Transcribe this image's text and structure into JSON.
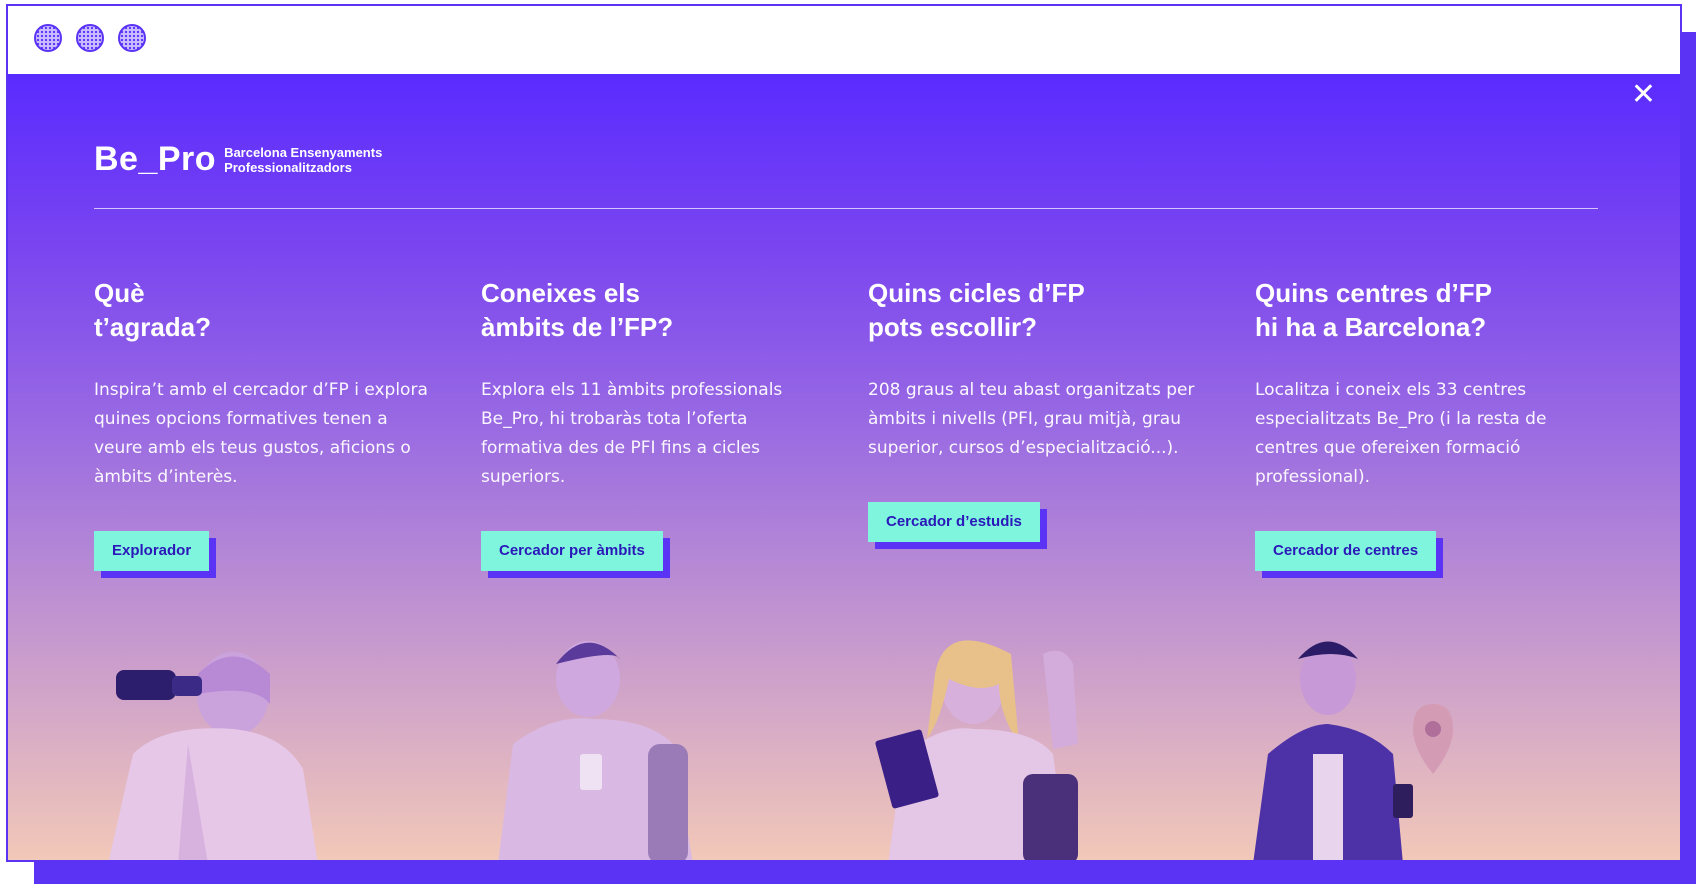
{
  "window": {
    "title": ""
  },
  "modal": {
    "close_label": "✕"
  },
  "logo": {
    "mark": "Be_Pro",
    "line1": "Barcelona Ensenyaments",
    "line2": "Professionalitzadors"
  },
  "columns": [
    {
      "title": "Què\nt’agrada?",
      "text": "Inspira’t amb el cercador d’FP i explora quines opcions formatives tenen a veure amb els teus gustos, aficions o àmbits d’interès.",
      "button": "Explorador"
    },
    {
      "title": "Coneixes els\nàmbits de l’FP?",
      "text": "Explora els 11 àmbits professionals Be_Pro, hi trobaràs tota l’oferta formativa des de PFI fins a cicles superiors.",
      "button": "Cercador per àmbits"
    },
    {
      "title": "Quins cicles d’FP\npots escollir?",
      "text": "208 graus al teu abast organitzats per àmbits i nivells (PFI, grau mitjà, grau superior, cursos d’especialització...).",
      "button": "Cercador d’estudis"
    },
    {
      "title": "Quins centres d’FP\nhi ha a Barcelona?",
      "text": "Localitza i coneix els 33 centres especialitzats Be_Pro (i la resta de centres que ofereixen formació professional).",
      "button": "Cercador de centres"
    }
  ],
  "colors": {
    "accent": "#5a33f5",
    "button_bg": "#7ff5de",
    "button_text": "#2a19b8"
  },
  "icons": [
    "close-icon",
    "window-dot"
  ]
}
